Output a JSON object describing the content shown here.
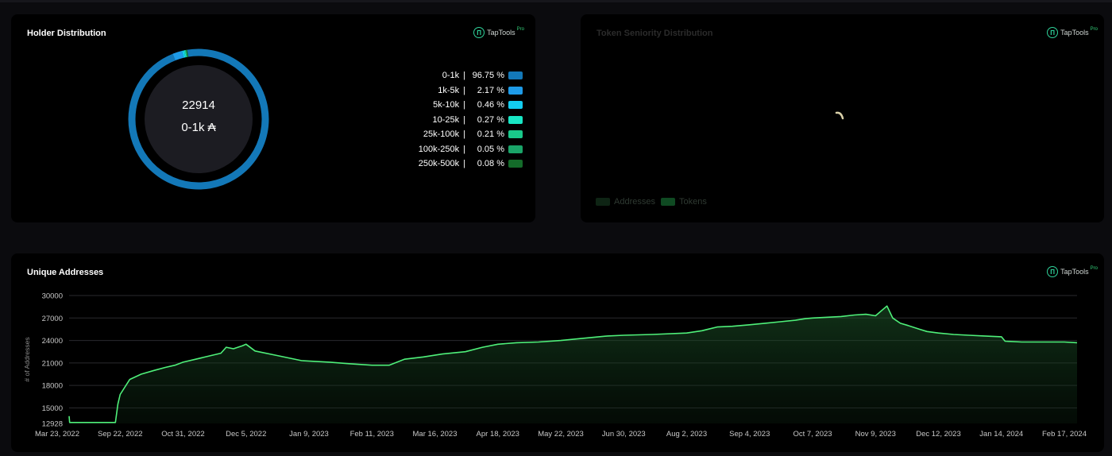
{
  "holder_distribution": {
    "title": "Holder Distribution",
    "brand": "TapTools",
    "brand_badge": "Pro",
    "center_count": "22914",
    "center_label": "0-1k ₳",
    "legend": [
      {
        "range": "0-1k",
        "sep": "|",
        "pct": "96.75 %",
        "color": "#1378b8"
      },
      {
        "range": "1k-5k",
        "sep": "|",
        "pct": "2.17 %",
        "color": "#1e9be8"
      },
      {
        "range": "5k-10k",
        "sep": "|",
        "pct": "0.46 %",
        "color": "#13cdf0"
      },
      {
        "range": "10-25k",
        "sep": "|",
        "pct": "0.27 %",
        "color": "#18e6c4"
      },
      {
        "range": "25k-100k",
        "sep": "|",
        "pct": "0.21 %",
        "color": "#19c98a"
      },
      {
        "range": "100k-250k",
        "sep": "|",
        "pct": "0.05 %",
        "color": "#1aa468"
      },
      {
        "range": "250k-500k",
        "sep": "|",
        "pct": "0.08 %",
        "color": "#146b2a"
      }
    ]
  },
  "seniority": {
    "title": "Token Seniority Distribution",
    "brand": "TapTools",
    "brand_badge": "Pro",
    "legend": [
      {
        "label": "Addresses",
        "color": "#0e2414"
      },
      {
        "label": "Tokens",
        "color": "#0f4a22"
      }
    ],
    "loading_icon": "spinner-icon"
  },
  "unique_addresses": {
    "title": "Unique Addresses",
    "brand": "TapTools",
    "brand_badge": "Pro"
  },
  "colors": {
    "line": "#4ff07a",
    "grid": "#2a2a2e",
    "brand": "#2fd39a"
  },
  "chart_data": [
    {
      "type": "pie",
      "title": "Holder Distribution",
      "categories": [
        "0-1k",
        "1k-5k",
        "5k-10k",
        "10-25k",
        "25k-100k",
        "100k-250k",
        "250k-500k"
      ],
      "values": [
        96.75,
        2.17,
        0.46,
        0.27,
        0.21,
        0.05,
        0.08
      ],
      "legend": "right"
    },
    {
      "type": "area",
      "title": "Unique Addresses",
      "ylabel": "# of Addresses",
      "xlabel": "",
      "y_ticks": [
        12928,
        15000,
        18000,
        21000,
        24000,
        27000,
        30000
      ],
      "ylim": [
        12928,
        30000
      ],
      "x_ticks": [
        "Mar 23, 2022",
        "Sep 22, 2022",
        "Oct 31, 2022",
        "Dec 5, 2022",
        "Jan 9, 2023",
        "Feb 11, 2023",
        "Mar 16, 2023",
        "Apr 18, 2023",
        "May 22, 2023",
        "Jun 30, 2023",
        "Aug 2, 2023",
        "Sep 4, 2023",
        "Oct 7, 2023",
        "Nov 9, 2023",
        "Dec 12, 2023",
        "Jan 14, 2024",
        "Feb 17, 2024"
      ],
      "grid": true,
      "series": [
        {
          "x": [
            "Mar 23, 2022",
            "Mar 25, 2022",
            "Sep 5, 2022",
            "Sep 14, 2022",
            "Sep 22, 2022",
            "Sep 28, 2022",
            "Oct 5, 2022",
            "Oct 13, 2022",
            "Oct 20, 2022",
            "Oct 26, 2022",
            "Oct 31, 2022",
            "Nov 7, 2022",
            "Nov 14, 2022",
            "Nov 21, 2022",
            "Nov 24, 2022",
            "Nov 28, 2022",
            "Dec 3, 2022",
            "Dec 5, 2022",
            "Dec 10, 2022",
            "Dec 22, 2022",
            "Jan 5, 2023",
            "Jan 20, 2023",
            "Jan 30, 2023",
            "Feb 11, 2023",
            "Feb 20, 2023",
            "Feb 28, 2023",
            "Mar 10, 2023",
            "Mar 20, 2023",
            "Apr 1, 2023",
            "Apr 10, 2023",
            "Apr 18, 2023",
            "Apr 28, 2023",
            "May 10, 2023",
            "May 22, 2023",
            "Jun 5, 2023",
            "Jun 20, 2023",
            "Jun 30, 2023",
            "Jul 15, 2023",
            "Aug 2, 2023",
            "Aug 10, 2023",
            "Aug 18, 2023",
            "Aug 26, 2023",
            "Sep 4, 2023",
            "Sep 12, 2023",
            "Sep 20, 2023",
            "Sep 28, 2023",
            "Oct 3, 2023",
            "Oct 7, 2023",
            "Oct 15, 2023",
            "Oct 22, 2023",
            "Oct 29, 2023",
            "Nov 4, 2023",
            "Nov 9, 2023",
            "Nov 15, 2023",
            "Nov 18, 2023",
            "Nov 22, 2023",
            "Nov 26, 2023",
            "Dec 2, 2023",
            "Dec 6, 2023",
            "Dec 12, 2023",
            "Dec 20, 2023",
            "Dec 28, 2023",
            "Jan 5, 2024",
            "Jan 14, 2024",
            "Jan 16, 2024",
            "Jan 25, 2024",
            "Feb 5, 2024",
            "Feb 17, 2024",
            "Feb 27, 2024"
          ],
          "values": [
            13900,
            13050,
            13050,
            15500,
            16800,
            18800,
            19500,
            20000,
            20400,
            20700,
            21100,
            21500,
            21900,
            22300,
            23100,
            22900,
            23300,
            23500,
            22600,
            22000,
            21300,
            21100,
            20900,
            20700,
            20700,
            21500,
            21800,
            22200,
            22500,
            23100,
            23500,
            23700,
            23800,
            24000,
            24300,
            24600,
            24700,
            24800,
            25000,
            25300,
            25800,
            25900,
            26100,
            26300,
            26500,
            26700,
            26900,
            27000,
            27100,
            27200,
            27400,
            27500,
            27300,
            28600,
            27000,
            26300,
            26000,
            25500,
            25200,
            25000,
            24800,
            24700,
            24600,
            24500,
            23900,
            23800,
            23800,
            23800,
            23700
          ]
        }
      ]
    }
  ]
}
